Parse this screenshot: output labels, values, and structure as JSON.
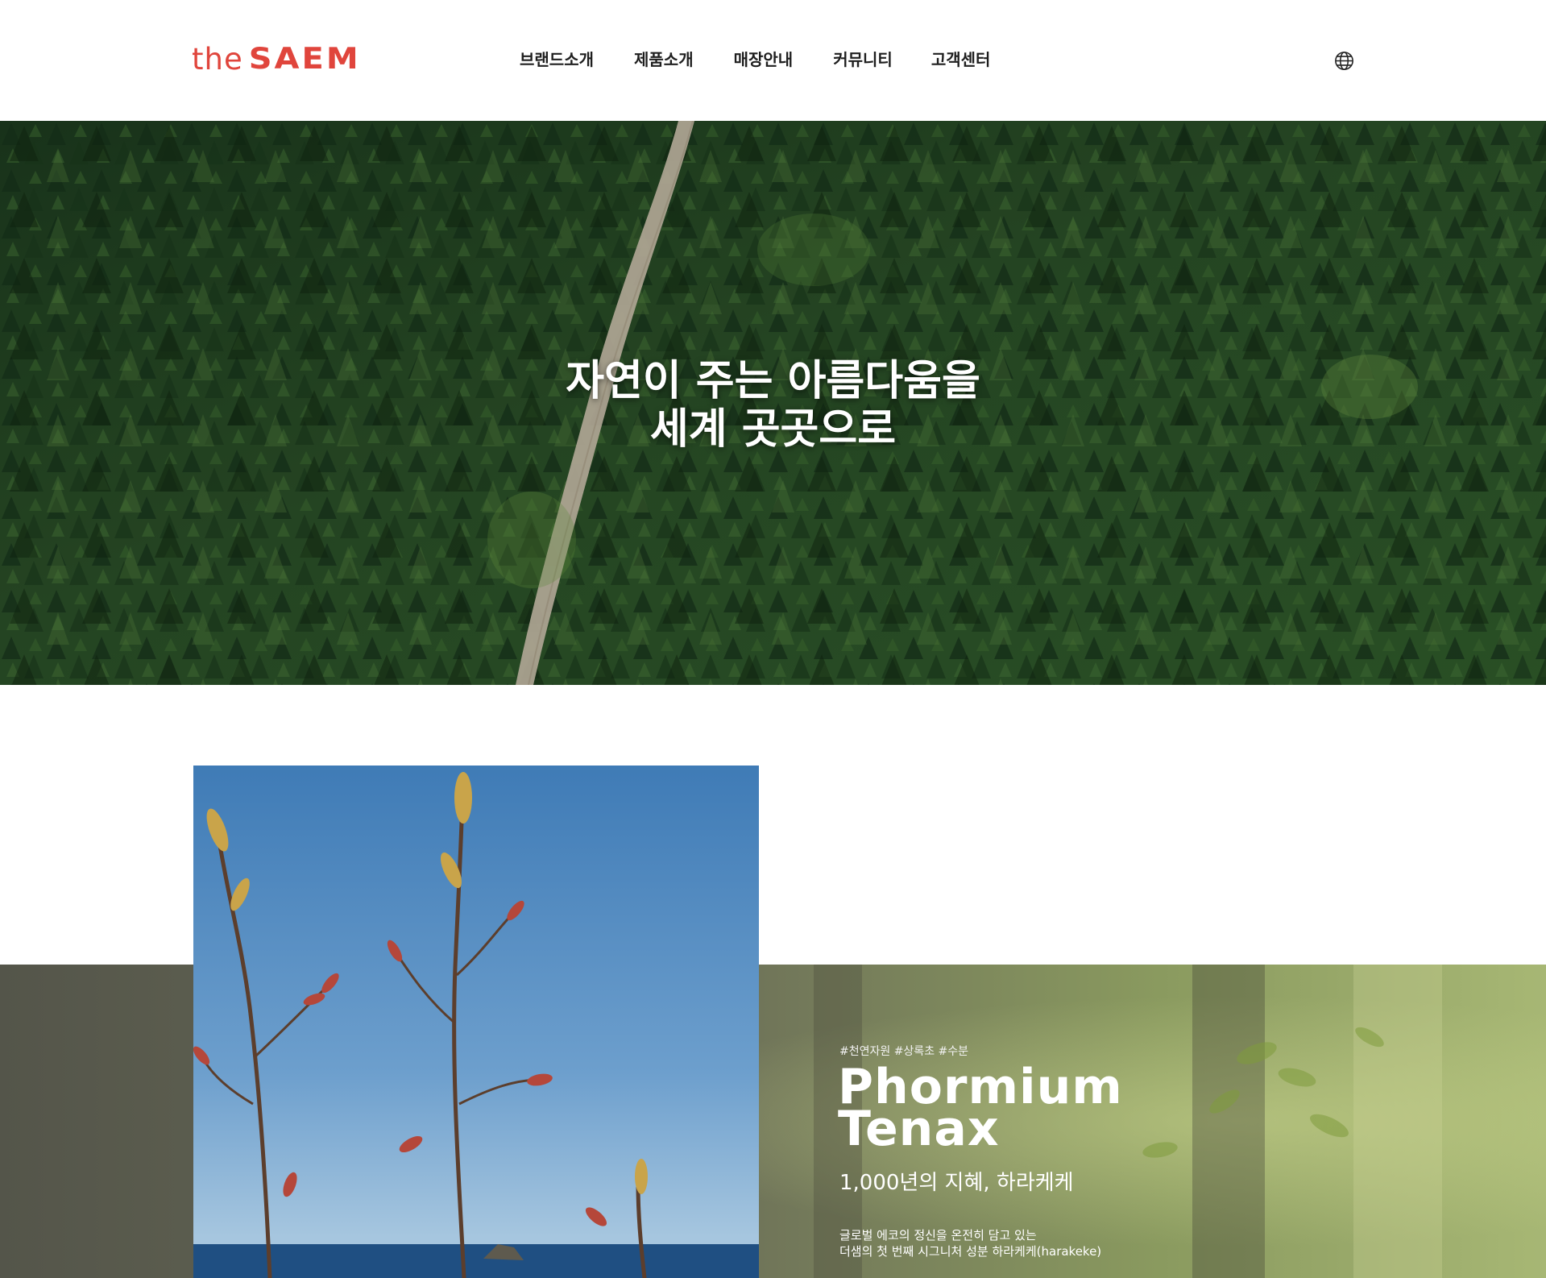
{
  "header": {
    "logo": {
      "prefix": "the",
      "brand": "SAEM",
      "color": "#e0453c"
    },
    "nav": [
      {
        "label": "브랜드소개"
      },
      {
        "label": "제품소개"
      },
      {
        "label": "매장안내"
      },
      {
        "label": "커뮤니티"
      },
      {
        "label": "고객센터"
      }
    ],
    "language_icon": "globe-icon"
  },
  "hero": {
    "line1": "자연이 주는 아름다움을",
    "line2": "세계 곳곳으로"
  },
  "feature": {
    "tags": "#천연자원 #상록초 #수분",
    "title_line1": "Phormium",
    "title_line2": "Tenax",
    "subtitle": "1,000년의 지혜, 하라케케",
    "desc_line1": "글로벌 에코의 정신을 온전히 담고 있는",
    "desc_line2": "더샘의 첫 번째 시그니처 성분 하라케케(harakeke)"
  }
}
